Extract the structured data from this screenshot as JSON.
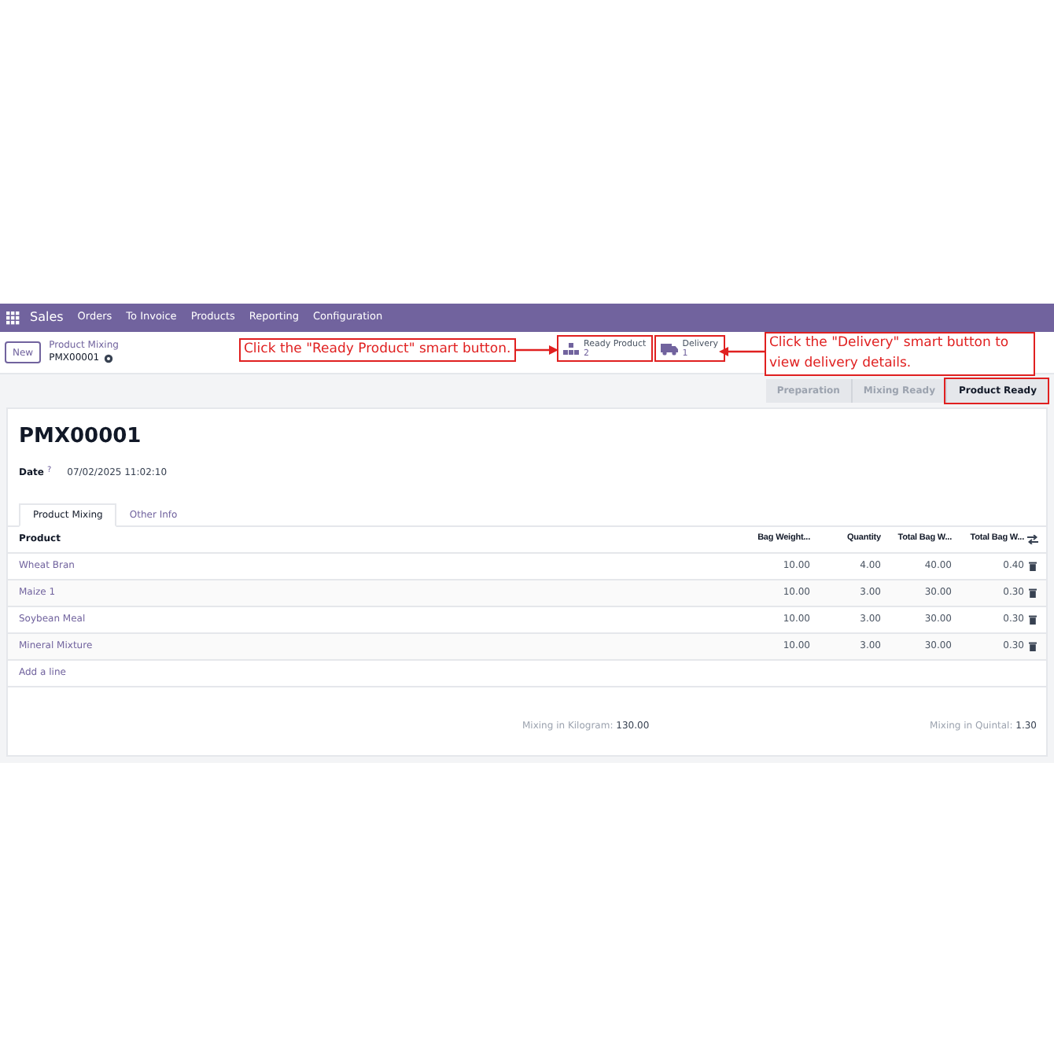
{
  "navbar": {
    "app": "Sales",
    "menu": [
      "Orders",
      "To Invoice",
      "Products",
      "Reporting",
      "Configuration"
    ]
  },
  "control_panel": {
    "new_button": "New",
    "breadcrumb": "Product Mixing",
    "record": "PMX00001"
  },
  "smart_buttons": [
    {
      "kind": "product",
      "label": "Ready Product",
      "count": "2",
      "highlighted": true
    },
    {
      "kind": "delivery",
      "label": "Delivery",
      "count": "1",
      "highlighted": true
    }
  ],
  "stages": [
    {
      "label": "Preparation",
      "selected": false,
      "highlighted": false
    },
    {
      "label": "Mixing Ready",
      "selected": false,
      "highlighted": false
    },
    {
      "label": "Product Ready",
      "selected": true,
      "highlighted": true
    }
  ],
  "form": {
    "title": "PMX00001",
    "date_label": "Date",
    "date_help": "?",
    "date_value": "07/02/2025 11:02:10"
  },
  "tabs": [
    {
      "label": "Product Mixing",
      "selected": true
    },
    {
      "label": "Other Info",
      "selected": false
    }
  ],
  "table": {
    "columns": [
      "Product",
      "Bag Weight...",
      "Quantity",
      "Total Bag W...",
      "Total Bag W..."
    ],
    "rows": [
      [
        "Wheat Bran",
        "10.00",
        "4.00",
        "40.00",
        "0.40"
      ],
      [
        "Maize 1",
        "10.00",
        "3.00",
        "30.00",
        "0.30"
      ],
      [
        "Soybean Meal",
        "10.00",
        "3.00",
        "30.00",
        "0.30"
      ],
      [
        "Mineral Mixture",
        "10.00",
        "3.00",
        "30.00",
        "0.30"
      ]
    ],
    "add_line": "Add a line"
  },
  "totals": [
    {
      "label": "Mixing in Kilogram:",
      "value": "130.00"
    },
    {
      "label": "Mixing in Quintal:",
      "value": "1.30"
    }
  ],
  "callouts": [
    {
      "text": "Click the \"Ready Product\" smart button."
    },
    {
      "text": "Click the \"Delivery\" smart button to view delivery details."
    }
  ]
}
